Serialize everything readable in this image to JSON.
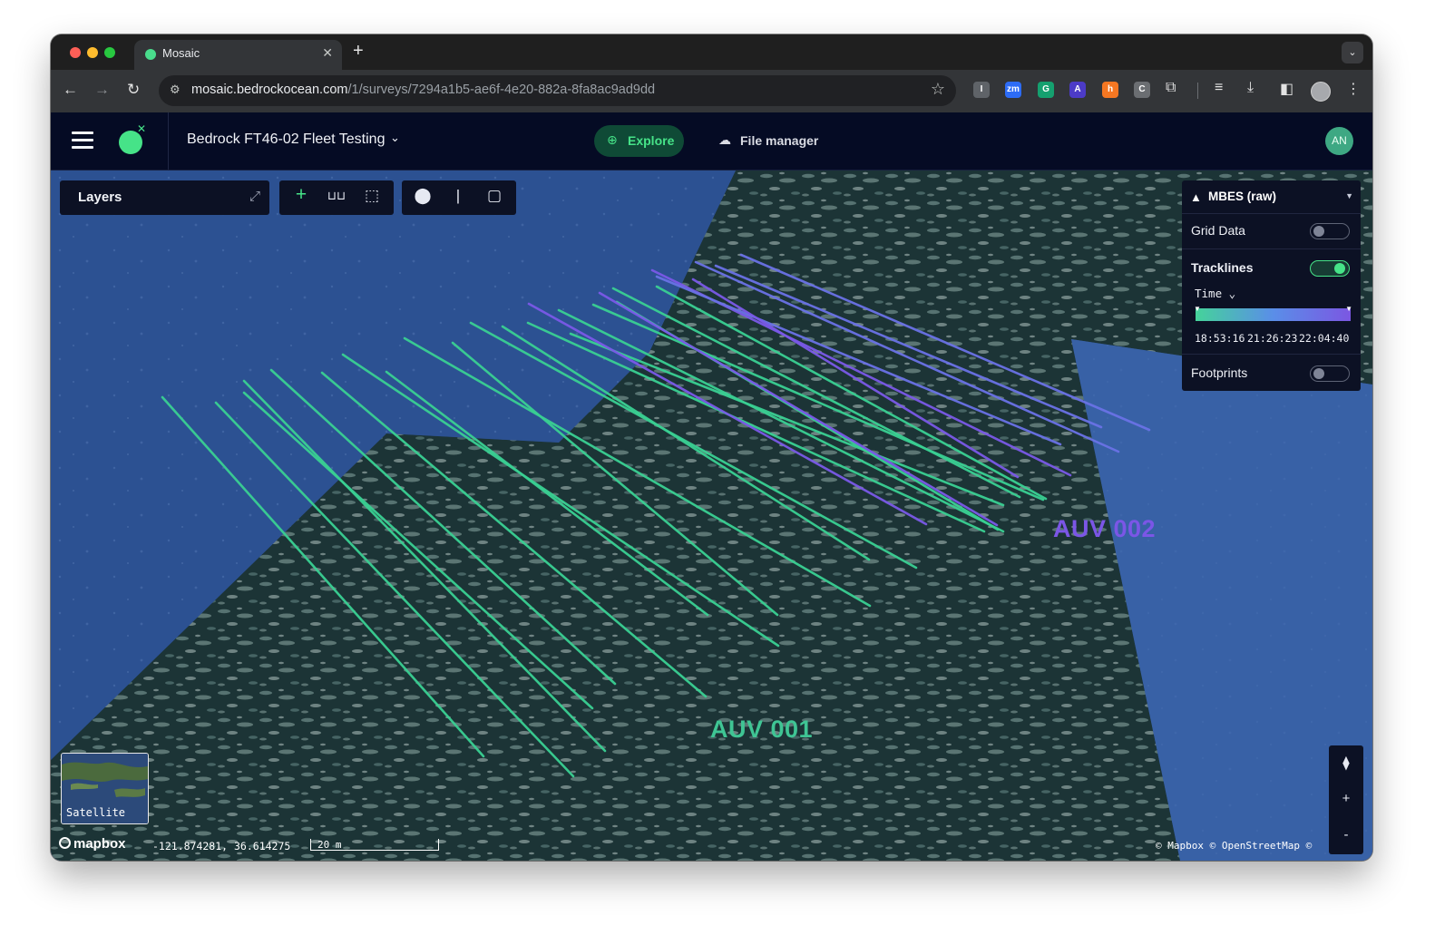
{
  "browser": {
    "tab_title": "Mosaic",
    "new_tab": "+",
    "url_host": "mosaic.bedrockocean.com",
    "url_path": "/1/surveys/7294a1b5-ae6f-4e20-882a-8fa8ac9ad9dd",
    "extensions": [
      {
        "name": "instapaper",
        "text": "I",
        "color": "#5f6368"
      },
      {
        "name": "zoom",
        "text": "zm",
        "color": "#2d6cf6"
      },
      {
        "name": "grammarly",
        "text": "G",
        "color": "#15a06f"
      },
      {
        "name": "adobe",
        "text": "A",
        "color": "#4c3bc7"
      },
      {
        "name": "hubspot",
        "text": "h",
        "color": "#f57722"
      },
      {
        "name": "privacy",
        "text": "C",
        "color": "#6b6e72"
      }
    ]
  },
  "header": {
    "project_name": "Bedrock FT46-02 Fleet Testing",
    "nav": {
      "explore": "Explore",
      "file_manager": "File manager"
    },
    "avatar_initials": "AN"
  },
  "map": {
    "layers_label": "Layers",
    "layer_panel": {
      "title": "MBES (raw)",
      "grid_data": {
        "label": "Grid Data",
        "on": false
      },
      "tracklines": {
        "label": "Tracklines",
        "on": true
      },
      "color_by": "Time",
      "time_ticks": [
        "18:53:16",
        "21:26:23",
        "22:04:40"
      ],
      "footprints": {
        "label": "Footprints",
        "on": false
      }
    },
    "labels": {
      "auv1": {
        "text": "AUV 001",
        "color": "#3fc594"
      },
      "auv2": {
        "text": "AUV 002",
        "color": "#7b56e6"
      }
    },
    "minimap_label": "Satellite",
    "mapbox_logo": "mapbox",
    "coordinates": "-121.874281, 36.614275",
    "scale_label": "20 m",
    "attribution": "© Mapbox © OpenStreetMap ©",
    "nav_controls": {
      "compass": "⧫",
      "zoom_in": "+",
      "zoom_out": "-"
    }
  },
  "colors": {
    "app_bg": "#050b24",
    "accent_green": "#46e388",
    "track_green": "#3ad093",
    "track_purple": "#7a59e8",
    "track_blue": "#6a72e6"
  }
}
